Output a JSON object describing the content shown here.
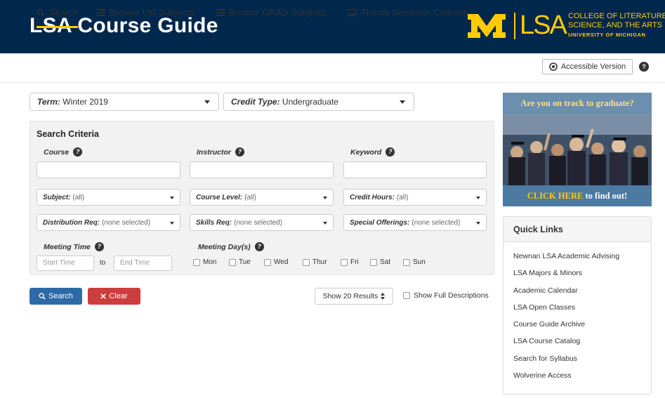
{
  "header": {
    "title": "LSA Course Guide",
    "brand_m": "M",
    "brand_lsa": "LSA",
    "brand_college_line1": "COLLEGE OF LITERATURE,",
    "brand_college_line2": "SCIENCE, AND THE ARTS",
    "brand_university": "UNIVERSITY OF MICHIGAN"
  },
  "nav": {
    "items": [
      {
        "label": "Search",
        "icon": "search-icon",
        "active": true
      },
      {
        "label": "Browse UG Subjects",
        "icon": "list-icon"
      },
      {
        "label": "Browse GRAD Subjects",
        "icon": "list-icon"
      },
      {
        "label": "Theme Semester Courses",
        "icon": "image-icon"
      }
    ],
    "accessible_label": "Accessible Version",
    "help": "?"
  },
  "filters": {
    "term_label": "Term:",
    "term_value": "Winter 2019",
    "credit_label": "Credit Type:",
    "credit_value": "Undergraduate"
  },
  "criteria": {
    "title": "Search Criteria",
    "course_label": "Course",
    "instructor_label": "Instructor",
    "keyword_label": "Keyword",
    "subject_label": "Subject:",
    "subject_value": "(all)",
    "level_label": "Course Level:",
    "level_value": "(all)",
    "hours_label": "Credit Hours:",
    "hours_value": "(all)",
    "dist_label": "Distribution Req:",
    "dist_value": "(none selected)",
    "skills_label": "Skills Req:",
    "skills_value": "(none selected)",
    "special_label": "Special Offerings:",
    "special_value": "(none selected)",
    "time_label": "Meeting Time",
    "start_placeholder": "Start Time",
    "to": "to",
    "end_placeholder": "End Time",
    "days_label": "Meeting Day(s)",
    "days": [
      "Mon",
      "Tue",
      "Wed",
      "Thur",
      "Fri",
      "Sat",
      "Sun"
    ]
  },
  "actions": {
    "search": "Search",
    "clear": "Clear",
    "results": "Show 20 Results",
    "full_desc": "Show Full Descriptions"
  },
  "promo": {
    "top": "Are you on track to graduate?",
    "bottom_highlight": "CLICK HERE",
    "bottom_rest": " to find out!"
  },
  "quick_links": {
    "title": "Quick Links",
    "items": [
      "Newnan LSA Academic Advising",
      "LSA Majors & Minors",
      "Academic Calendar",
      "LSA Open Classes",
      "Course Guide Archive",
      "LSA Course Catalog",
      "Search for Syllabus",
      "Wolverine Access"
    ]
  },
  "colors": {
    "navy": "#00274c",
    "maize": "#ffcb05",
    "search_blue": "#2e6aa8",
    "clear_red": "#cc3d3d"
  }
}
